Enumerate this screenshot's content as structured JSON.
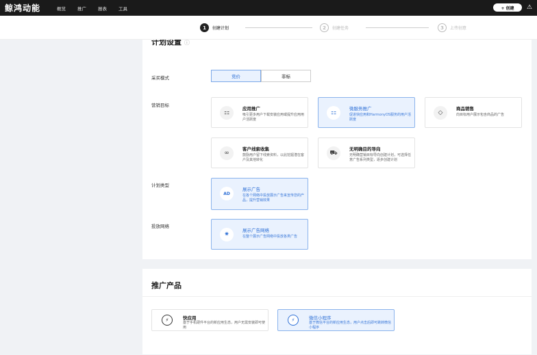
{
  "app": {
    "title": "鲸鸿动能",
    "nav": [
      "概览",
      "推广",
      "报表",
      "工具"
    ],
    "create_label": "+ 创建",
    "warn_icon": "⚠"
  },
  "steps": [
    {
      "num": "1",
      "label": "创建计划"
    },
    {
      "num": "2",
      "label": "创建任务"
    },
    {
      "num": "3",
      "label": "上传创意"
    }
  ],
  "settings": {
    "title": "计划设置",
    "info_icon": "ⓘ",
    "labels": {
      "purchase_mode": "采买模式",
      "marketing_goal": "营销目标",
      "plan_type": "计划类型",
      "network": "投放网络"
    },
    "purchase_options": [
      "竞价",
      "非标"
    ],
    "goals": [
      {
        "title": "应用推广",
        "desc": "吸引更多用户下载安装应用或提升应用用户活跃度",
        "icon": "⚏"
      },
      {
        "title": "微服务推广",
        "desc": "促进快应用和HarmonyOS服务的用户活跃度",
        "icon": "⚏"
      },
      {
        "title": "商品销售",
        "desc": "向目标用户展示包含商品的广告",
        "icon": "◇"
      },
      {
        "title": "客户线索收集",
        "desc": "鼓励用户留下线索资料，以此挖掘潜在客户及其他转化",
        "icon": "∞"
      },
      {
        "title": "无明确目的导向",
        "desc": "无明确营销目标导向创建计划，可选择任意广告系列类型，逐步创建计划",
        "icon": "⛟"
      }
    ],
    "plan_type": {
      "title": "展示广告",
      "desc": "在各个网络中投放展示广告来宣传您的产品，提升营销效果",
      "icon": "AD"
    },
    "network": {
      "title": "展示广告网络",
      "desc": "在整个展示广告网络中投放各类广告",
      "icon": "✷"
    }
  },
  "promo": {
    "title": "推广产品",
    "items": [
      {
        "title": "快应用",
        "desc": "基于手机硬件平台的新应用生态，用户无需安装即可使用",
        "icon": "⚡"
      },
      {
        "title": "微信小程序",
        "desc": "基于微信平台的新应用生态，用户点击后即可跳转微信小程序",
        "icon": "⚡"
      }
    ]
  }
}
